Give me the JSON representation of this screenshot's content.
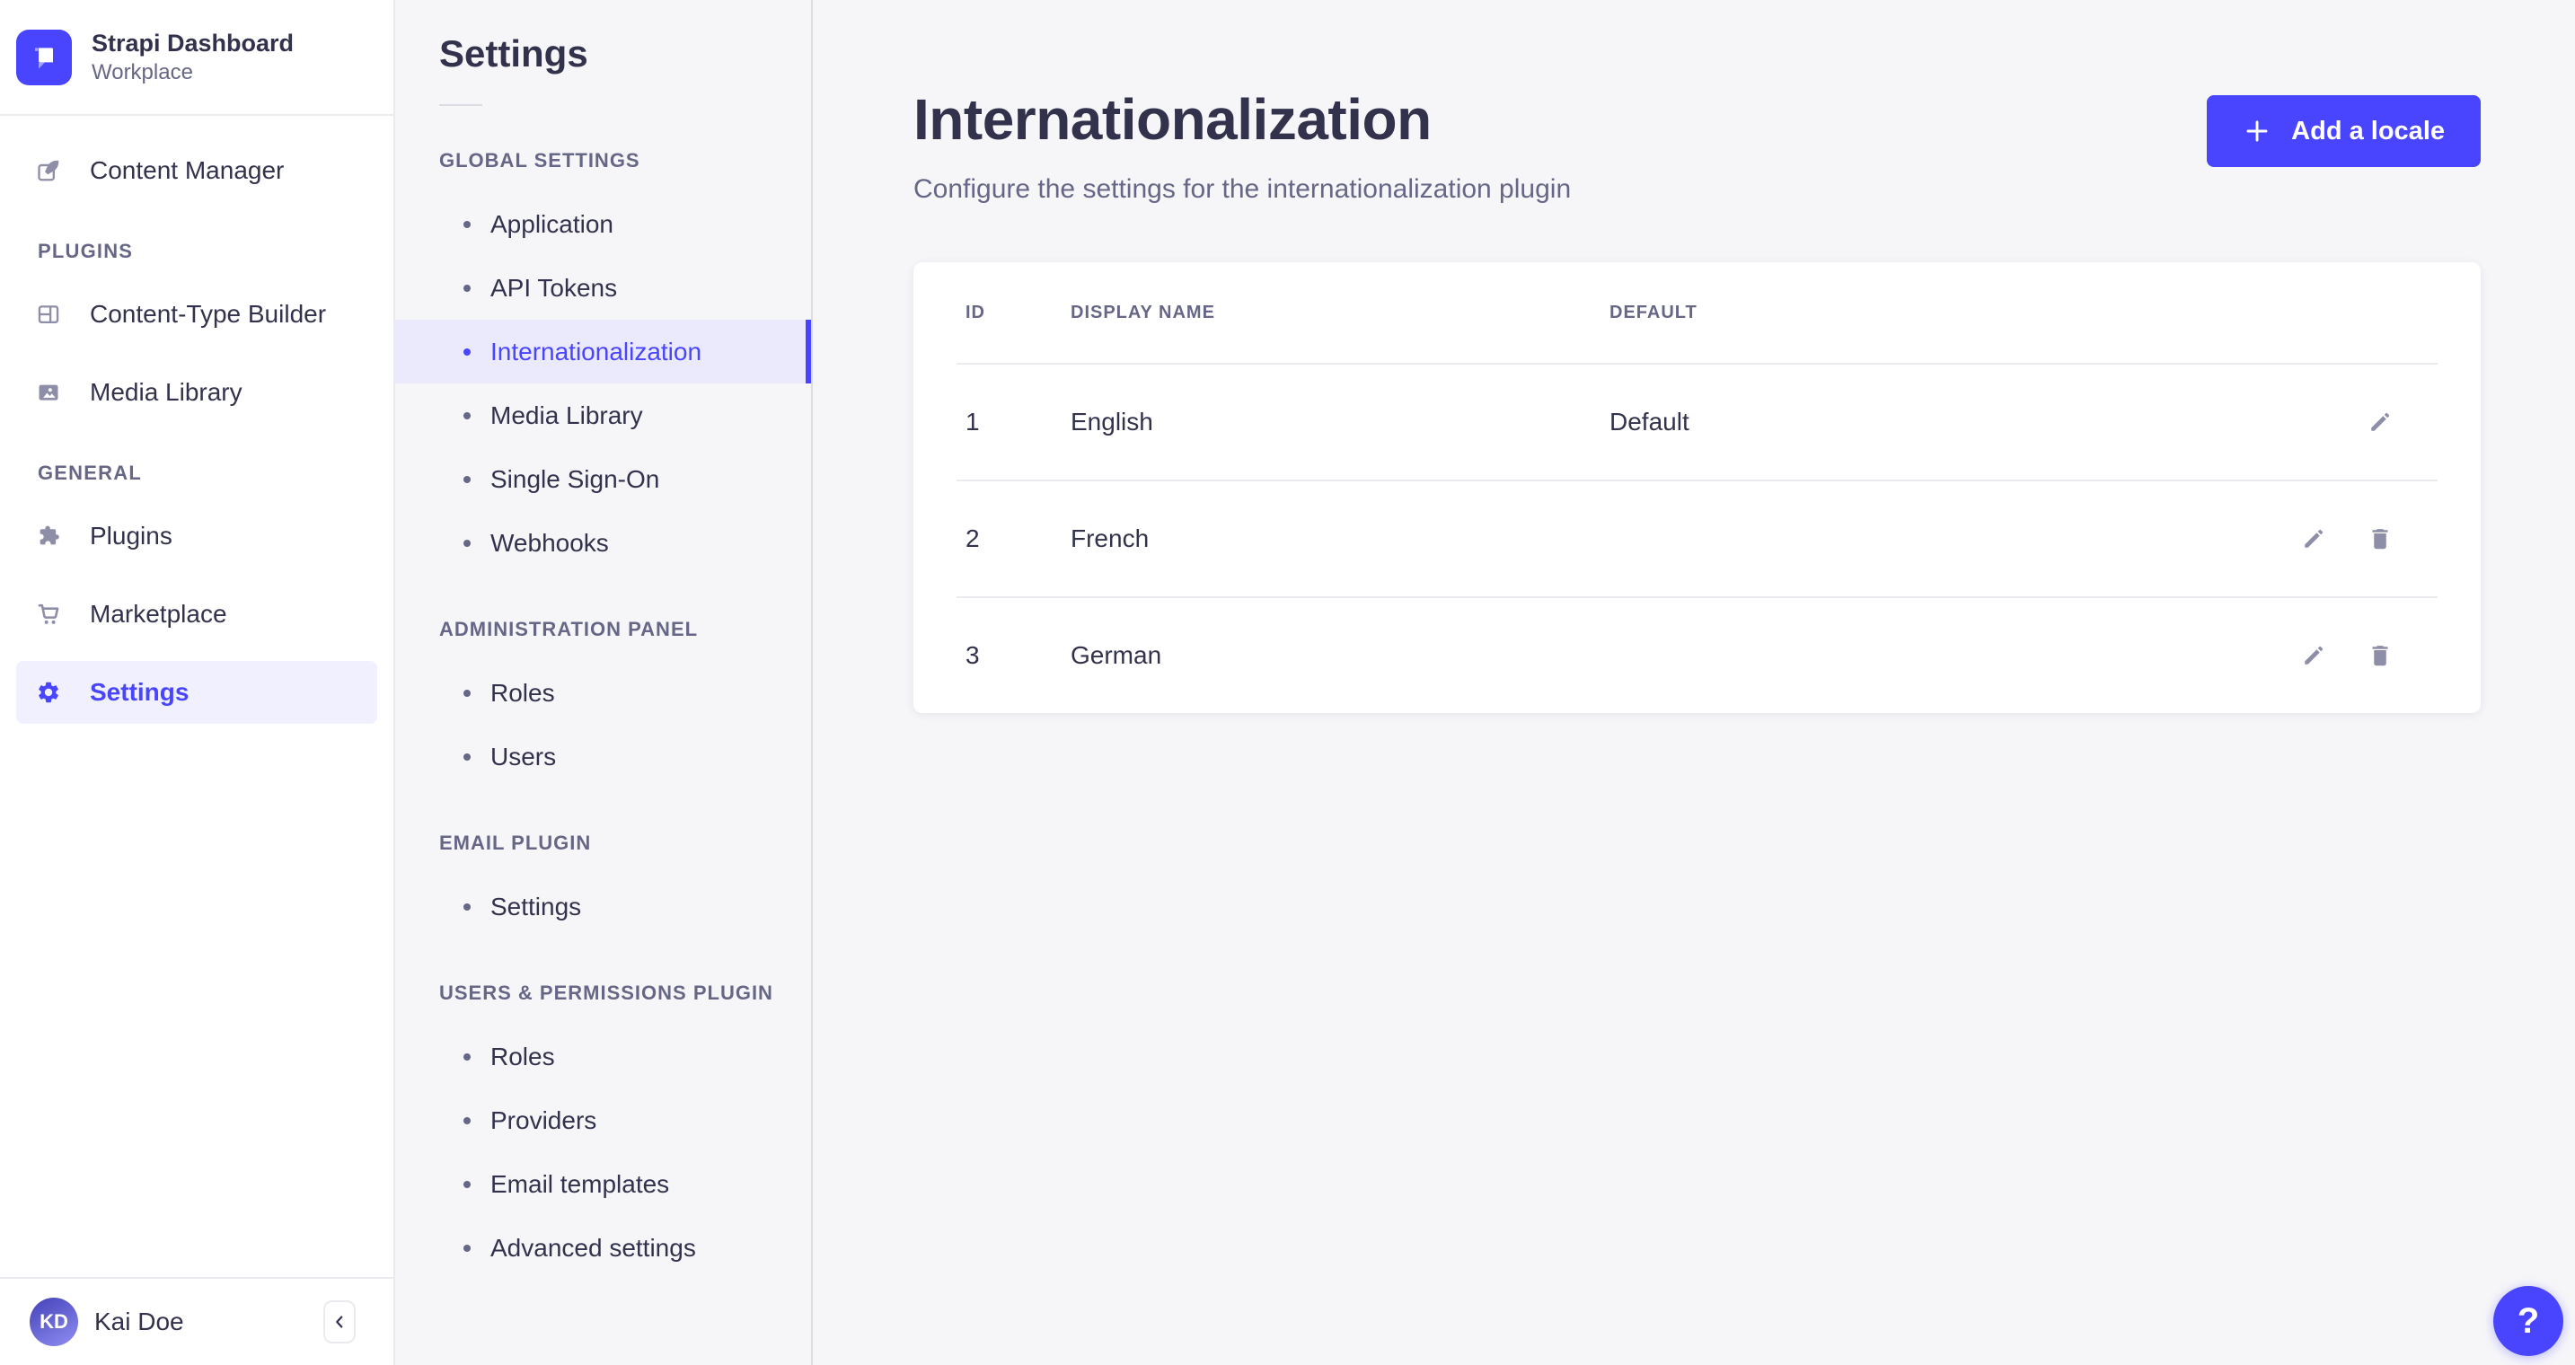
{
  "brand": {
    "name": "Strapi Dashboard",
    "workspace": "Workplace"
  },
  "sidebar": {
    "content_manager": "Content Manager",
    "sections": [
      {
        "label": "PLUGINS",
        "items": [
          "Content-Type Builder",
          "Media Library"
        ]
      },
      {
        "label": "GENERAL",
        "items": [
          "Plugins",
          "Marketplace",
          "Settings"
        ]
      }
    ],
    "active_item": "Settings",
    "user": {
      "initials": "KD",
      "name": "Kai Doe"
    }
  },
  "settings_nav": {
    "title": "Settings",
    "sections": [
      {
        "label": "GLOBAL SETTINGS",
        "items": [
          "Application",
          "API Tokens",
          "Internationalization",
          "Media Library",
          "Single Sign-On",
          "Webhooks"
        ]
      },
      {
        "label": "ADMINISTRATION PANEL",
        "items": [
          "Roles",
          "Users"
        ]
      },
      {
        "label": "EMAIL PLUGIN",
        "items": [
          "Settings"
        ]
      },
      {
        "label": "USERS & PERMISSIONS PLUGIN",
        "items": [
          "Roles",
          "Providers",
          "Email templates",
          "Advanced settings"
        ]
      }
    ],
    "active_item": "Internationalization"
  },
  "content": {
    "title": "Internationalization",
    "subtitle": "Configure the settings for the internationalization plugin",
    "add_button_label": "Add a locale",
    "table": {
      "headers": {
        "id": "ID",
        "display_name": "DISPLAY NAME",
        "default": "DEFAULT"
      },
      "rows": [
        {
          "id": "1",
          "display_name": "English",
          "default": "Default"
        },
        {
          "id": "2",
          "display_name": "French",
          "default": ""
        },
        {
          "id": "3",
          "display_name": "German",
          "default": ""
        }
      ]
    }
  },
  "help": {
    "label": "?"
  },
  "colors": {
    "primary": "#4945ff",
    "primary_light": "#f0f0ff",
    "subnav_active_bg": "#eaeafc",
    "background": "#f6f6f9",
    "surface": "#ffffff",
    "text": "#32324d",
    "text_muted": "#666687",
    "icon_muted": "#8e8ea9",
    "border": "#eaeaef"
  }
}
